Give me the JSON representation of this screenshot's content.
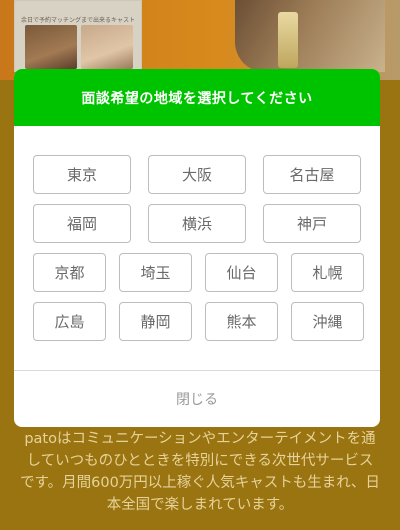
{
  "background": {
    "card_caption": "余日で予約マッチングまで出来るキャスト",
    "description": "patoはコミュニケーションやエンターテイメントを通していつものひとときを特別にできる次世代サービスです。月間600万円以上稼ぐ人気キャストも生まれ、日本全国で楽しまれています。"
  },
  "modal": {
    "title": "面談希望の地域を選択してください",
    "regions_row1": [
      "東京",
      "大阪",
      "名古屋"
    ],
    "regions_row2": [
      "福岡",
      "横浜",
      "神戸"
    ],
    "regions_row3": [
      "京都",
      "埼玉",
      "仙台",
      "札幌"
    ],
    "regions_row4": [
      "広島",
      "静岡",
      "熊本",
      "沖縄"
    ],
    "close_label": "閉じる"
  },
  "colors": {
    "header_green": "#00c300",
    "overlay": "#9a7410",
    "button_border": "#bdbdbd"
  }
}
